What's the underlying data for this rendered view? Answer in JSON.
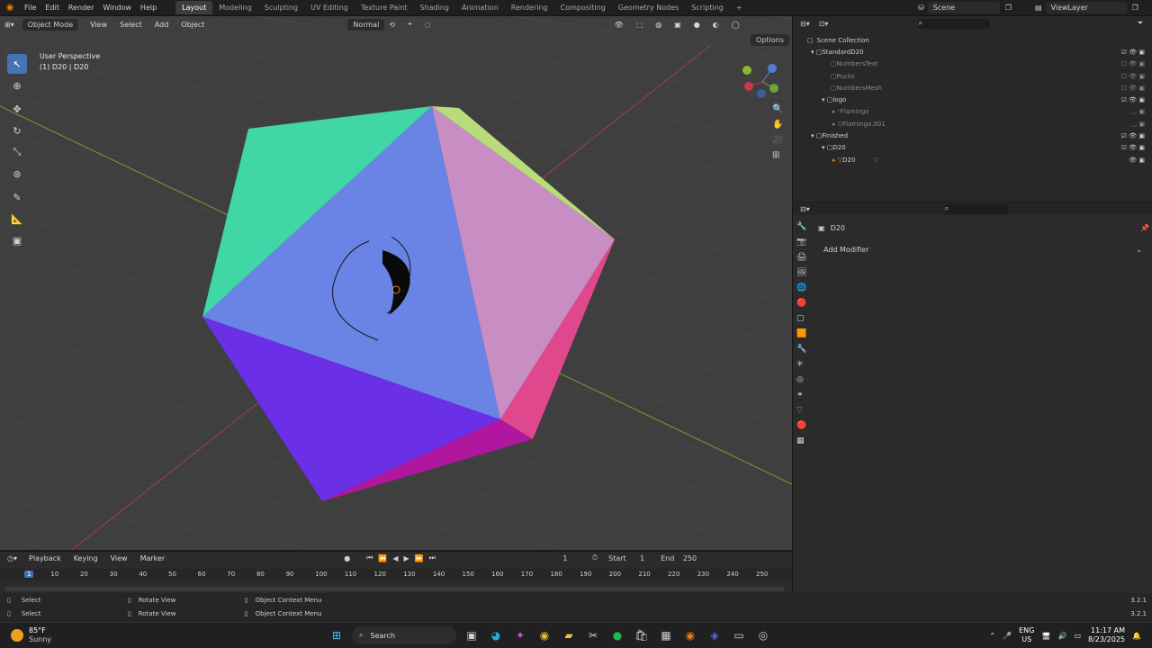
{
  "menu": [
    "File",
    "Edit",
    "Render",
    "Window",
    "Help"
  ],
  "workspaces": [
    "Layout",
    "Modeling",
    "Sculpting",
    "UV Editing",
    "Texture Paint",
    "Shading",
    "Animation",
    "Rendering",
    "Compositing",
    "Geometry Nodes",
    "Scripting"
  ],
  "active_workspace": "Layout",
  "scene_name": "Scene",
  "viewlayer_name": "ViewLayer",
  "viewport": {
    "mode": "Object Mode",
    "menus": [
      "View",
      "Select",
      "Add",
      "Object"
    ],
    "transform_orientation": "Normal",
    "options_label": "Options",
    "perspective_label": "User Perspective",
    "object_label": "(1) D20 | D20"
  },
  "outliner": {
    "rows": [
      {
        "label": "Scene Collection",
        "depth": 0
      },
      {
        "label": "StandardD20",
        "depth": 1
      },
      {
        "label": "NumbersText",
        "depth": 2
      },
      {
        "label": "Pucks",
        "depth": 2
      },
      {
        "label": "NumbersMesh",
        "depth": 2
      },
      {
        "label": "logo",
        "depth": 1
      },
      {
        "label": "Flamingo",
        "depth": 2
      },
      {
        "label": "Flamingo.001",
        "depth": 2
      },
      {
        "label": "Finished",
        "depth": 1
      },
      {
        "label": "D20",
        "depth": 2
      },
      {
        "label": "D20",
        "depth": 3
      }
    ]
  },
  "properties": {
    "object_name": "D20",
    "add_modifier": "Add Modifier"
  },
  "timeline": {
    "menus": [
      "Playback",
      "Keying",
      "View",
      "Marker"
    ],
    "current_frame": "1",
    "start_label": "Start",
    "start": "1",
    "end_label": "End",
    "end": "250",
    "ticks": [
      "1",
      "10",
      "20",
      "30",
      "40",
      "50",
      "60",
      "70",
      "80",
      "90",
      "100",
      "110",
      "120",
      "130",
      "140",
      "150",
      "160",
      "170",
      "180",
      "190",
      "200",
      "210",
      "220",
      "230",
      "240",
      "250"
    ]
  },
  "status": {
    "row1": [
      "Select",
      "Rotate View",
      "Object Context Menu"
    ],
    "row2": [
      "Select",
      "Rotate View",
      "Object Context Menu"
    ],
    "version": "3.2.1"
  },
  "taskbar": {
    "weather_temp": "85°F",
    "weather_desc": "Sunny",
    "search_label": "Search",
    "lang": "ENG",
    "region": "US",
    "time": "11:17 AM",
    "date": "8/23/2025"
  }
}
